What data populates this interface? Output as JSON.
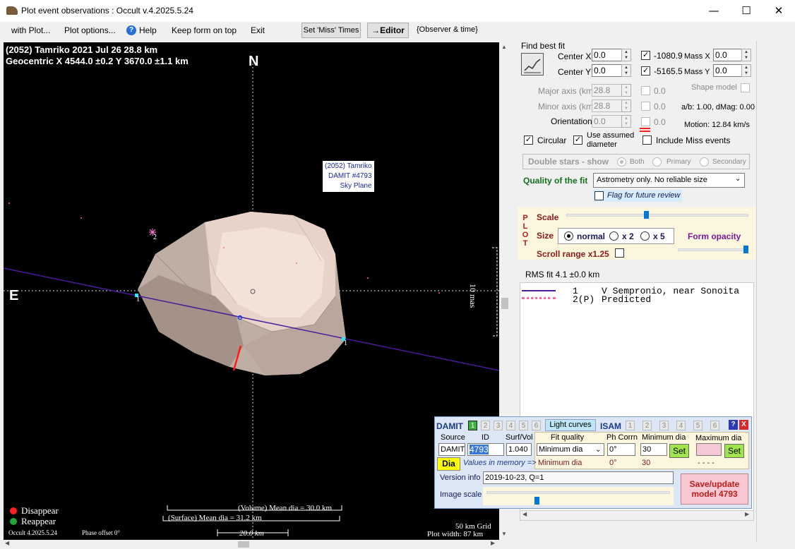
{
  "window": {
    "title": "Plot event observations : Occult v.4.2025.5.24",
    "minimize": "—",
    "maximize": "☐",
    "close": "✕"
  },
  "menu": {
    "with_plot": "with Plot...",
    "plot_options": "Plot options...",
    "help": "Help",
    "keep_form_on_top": "Keep form on top",
    "exit": "Exit",
    "set_miss_times": "Set 'Miss' Times",
    "editor": "→Editor",
    "observer_time": "{Observer & time}"
  },
  "plot": {
    "title_line1": "(2052) Tamriko  2021 Jul 26   28.8 km",
    "title_line2": "Geocentric  X  4544.0 ±0.2  Y 3670.0 ±1.1 km",
    "north": "N",
    "east": "E",
    "model_label": [
      "(2052) Tamriko",
      "DAMIT #4793",
      "Sky Plane"
    ],
    "scale_mas": "10 mas",
    "chord_left_num": "1",
    "chord_right_num": "1",
    "star2_num": "2",
    "volume_dia": "(Volume) Mean dia = 30.0 km",
    "surface_dia": "(Surface) Mean dia = 31.2 km",
    "scale_km": "20.0 km",
    "disappear": "Disappear",
    "reappear": "Reappear",
    "version": "Occult 4.2025.5.24",
    "phase_offset": "Phase offset 0°",
    "grid": "50 km Grid",
    "plot_width": "Plot width: 87 km",
    "colors": {
      "chord": "#4b1a9a",
      "model": "#d8c4b8",
      "disappear": "#ff2020",
      "reappear": "#1fa83a",
      "cyan": "#2ee6f0"
    }
  },
  "fit": {
    "find_best_fit": "Find best fit",
    "center_x_label": "Center X",
    "center_x": "0.0",
    "center_y_label": "Center Y",
    "center_y": "0.0",
    "x_value": "-1080.9",
    "y_value": "-5165.5",
    "mass_x_label": "Mass X",
    "mass_x": "0.0",
    "mass_y_label": "Mass Y",
    "mass_y": "0.0",
    "major_axis_label": "Major axis (km)",
    "major_axis": "28.8",
    "minor_axis_label": "Minor axis (km)",
    "minor_axis": "28.8",
    "orientation_label": "Orientation",
    "orientation": "0.0",
    "disabled_val_1": "0.0",
    "disabled_val_2": "0.0",
    "disabled_val_3": "0.0",
    "shape_model": "Shape model",
    "ab_dmag": "a/b: 1.00, dMag: 0.00",
    "motion": "Motion: 12.84 km/s",
    "circular": "Circular",
    "use_assumed": "Use assumed",
    "diameter": "diameter",
    "include_miss": "Include Miss events",
    "double_stars": "Double stars - show",
    "both": "Both",
    "primary": "Primary",
    "secondary": "Secondary",
    "quality_label": "Quality of the fit",
    "quality_value": "Astrometry only. No reliable size",
    "flag_review": "Flag for future review"
  },
  "plotctl": {
    "vertical": [
      "P",
      "L",
      "O",
      "T"
    ],
    "scale": "Scale",
    "scale_level": 0.44,
    "size": "Size",
    "normal": "normal",
    "x2": "x 2",
    "x5": "x 5",
    "form_opacity": "Form opacity",
    "opacity_level": 1.0,
    "scroll_range": "Scroll range x1.25"
  },
  "rms": "RMS fit 4.1 ±0.0 km",
  "legend": [
    {
      "num": "1",
      "text": "V Sempronio, near Sonoita"
    },
    {
      "num": "2(P)",
      "text": "Predicted"
    }
  ],
  "damit": {
    "title": "DAMIT",
    "tabs": [
      "1",
      "2",
      "3",
      "4",
      "5",
      "6"
    ],
    "light_curves": "Light curves",
    "isam": "ISAM",
    "isam_tabs": [
      "1",
      "2",
      "3",
      "4",
      "5",
      "6"
    ],
    "help": "?",
    "close": "X",
    "source_h": "Source",
    "id_h": "ID",
    "surfvol_h": "Surf/Vol",
    "fitq_h": "Fit quality",
    "phcorr_h": "Ph Corrn",
    "mindia_h": "Minimum dia",
    "maxdia_h": "Maximum dia",
    "source": "DAMIT",
    "id": "4793",
    "surfvol": "1.040",
    "fitq": "Minimum dia",
    "phcorr": "0°",
    "mindia": "30",
    "set": "Set",
    "set2": "Set",
    "dia": "Dia",
    "values_in_memory": "Values in memory =>",
    "mem_fitq": "Minimum dia",
    "mem_phcorr": "0°",
    "mem_mindia": "30",
    "mem_maxdia": "- - - -",
    "version_label": "Version info",
    "version_value": "2019-10-23, Q=1",
    "image_scale": "Image scale",
    "image_scale_level": 0.27,
    "save_update": "Save/update",
    "model": "model 4793"
  }
}
